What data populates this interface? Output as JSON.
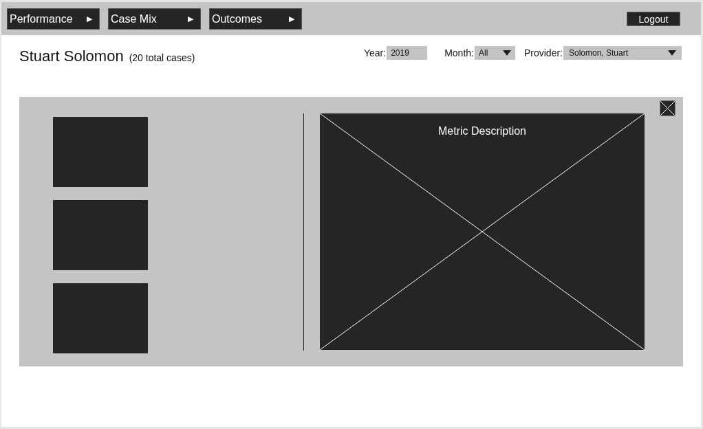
{
  "nav": [
    {
      "label": "Performance",
      "arrow": "▶"
    },
    {
      "label": "Case Mix",
      "arrow": "▶"
    },
    {
      "label": "Outcomes",
      "arrow": "▶"
    }
  ],
  "logout": "Logout",
  "header": {
    "name": "Stuart Solomon",
    "count": "(20 total cases)"
  },
  "filters": [
    {
      "kind": "input",
      "label": "Year:",
      "value": "2019"
    },
    {
      "kind": "select",
      "label": "Month:",
      "value": "All"
    },
    {
      "kind": "select",
      "label": "Provider:",
      "value": "Solomon, Stuart"
    }
  ],
  "panel": {
    "tiles": [
      {
        "kind": "placeholder"
      },
      {
        "kind": "placeholder"
      },
      {
        "kind": "placeholder"
      }
    ],
    "detail": {
      "title": "Metric Description"
    }
  }
}
